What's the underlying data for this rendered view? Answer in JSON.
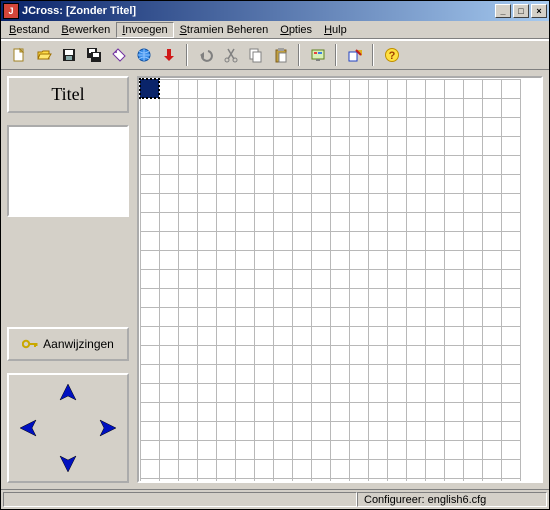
{
  "window": {
    "title": "JCross: [Zonder Titel]"
  },
  "menu": {
    "items": [
      {
        "label": "Bestand",
        "ul": "B",
        "rest": "estand"
      },
      {
        "label": "Bewerken",
        "ul": "B",
        "rest": "ewerken"
      },
      {
        "label": "Invoegen",
        "ul": "I",
        "rest": "nvoegen",
        "active": true
      },
      {
        "label": "Stramien Beheren",
        "ul": "S",
        "rest": "tramien Beheren"
      },
      {
        "label": "Opties",
        "ul": "O",
        "rest": "pties"
      },
      {
        "label": "Hulp",
        "ul": "H",
        "rest": "ulp"
      }
    ]
  },
  "toolbar_icons": [
    "new",
    "open",
    "save",
    "savedisk",
    "tag",
    "web",
    "arrowdown",
    "sep",
    "undo",
    "cut",
    "copy",
    "paste",
    "sep",
    "screen",
    "sep",
    "export",
    "sep",
    "help"
  ],
  "left": {
    "title_label": "Titel",
    "hints_label": "Aanwijzingen"
  },
  "grid": {
    "cols": 20,
    "rows": 22,
    "selected": {
      "row": 0,
      "col": 0
    }
  },
  "status": {
    "right": "Configureer: english6.cfg"
  }
}
